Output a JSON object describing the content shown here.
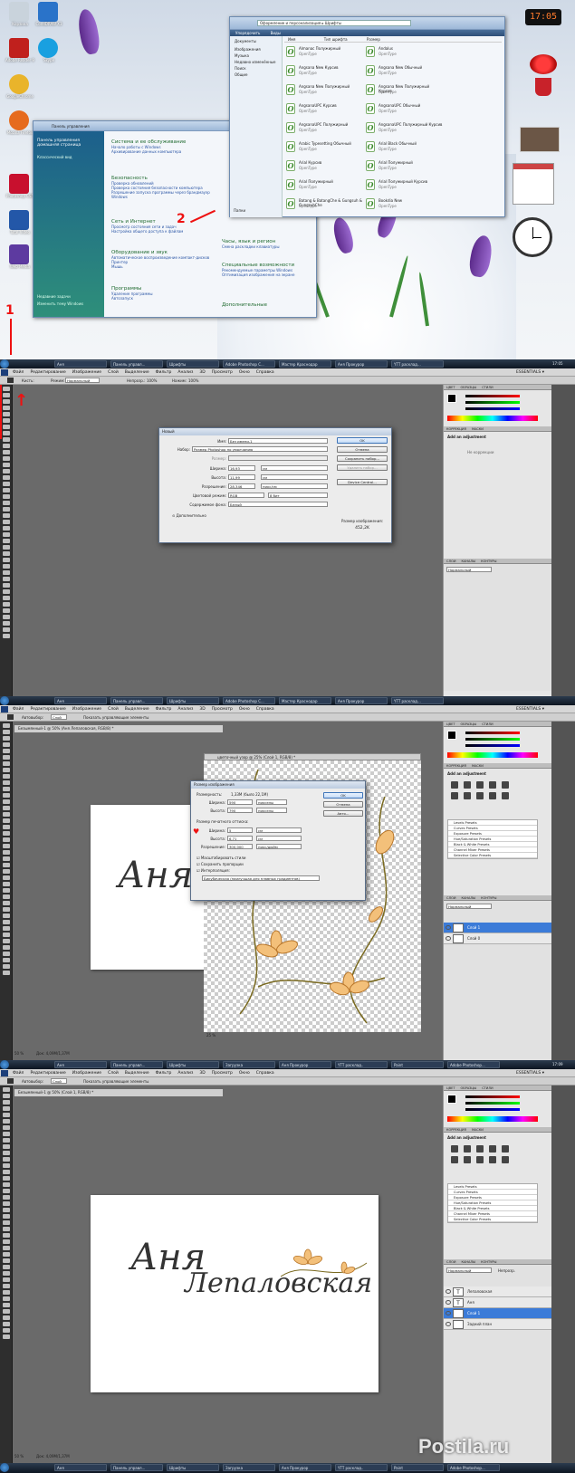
{
  "colors": {
    "accent_red": "#e11",
    "ps_bg": "#6a6a6a",
    "layer_selected": "#3b7bd8",
    "taskbar": "#0e1622"
  },
  "desktop": {
    "icons": [
      {
        "label": "Корзина",
        "icon": "recycle-bin-icon"
      },
      {
        "label": "Adobe Reader 9",
        "icon": "adobe-reader-icon"
      },
      {
        "label": "CorelDRAW X3",
        "icon": "corel-icon"
      },
      {
        "label": "Skype",
        "icon": "skype-icon"
      },
      {
        "label": "GoogleChrome",
        "icon": "chrome-icon"
      },
      {
        "label": "Mozilla Firefox",
        "icon": "firefox-icon"
      },
      {
        "label": "Photoshop CS5",
        "icon": "photoshop-icon"
      },
      {
        "label": "Total Video",
        "icon": "video-icon"
      },
      {
        "label": "Web Media",
        "icon": "media-icon"
      }
    ],
    "clock_digital": "17:05",
    "red_annotations": [
      "1",
      "2"
    ],
    "control_panel": {
      "title": "Панель управления",
      "left_links": [
        "Панель управления домашняя страница",
        "Классический вид"
      ],
      "bottom_links": [
        "Недавние задачи",
        "Изменить тему Windows"
      ],
      "sections": [
        {
          "title": "Система и ее обслуживание",
          "subs": [
            "Начало работы с Windows",
            "Архивирование данных компьютера"
          ]
        },
        {
          "title": "Безопасность",
          "subs": [
            "Проверка обновлений",
            "Проверка состояния безопасности компьютера",
            "Разрешение запуска программы через брандмауэр Windows"
          ]
        },
        {
          "title": "Сеть и Интернет",
          "subs": [
            "Просмотр состояния сети и задач",
            "Настройка общего доступа к файлам"
          ]
        },
        {
          "title": "Оборудование и звук",
          "subs": [
            "Автоматическое воспроизведение компакт-дисков",
            "Принтер",
            "Мышь"
          ]
        },
        {
          "title": "Программы",
          "subs": [
            "Удаление программы",
            "Автозапуск"
          ]
        }
      ],
      "right_sections": [
        {
          "title": "Часы, язык и регион",
          "subs": [
            "Смена раскладки клавиатуры"
          ]
        },
        {
          "title": "Специальные возможности",
          "subs": [
            "Рекомендуемые параметры Windows",
            "Оптимизация изображения на экране"
          ]
        },
        {
          "title": "Дополнительные",
          "subs": []
        }
      ]
    },
    "fonts_window": {
      "breadcrumb": "Оформление и персонализация ▸ Шрифты",
      "toolbar": [
        "Упорядочить",
        "Виды"
      ],
      "columns": [
        "Имя",
        "Тип шрифта",
        "Размер"
      ],
      "sidebar": [
        "Документы",
        "Изображения",
        "Музыка",
        "Недавно изменённые",
        "Поиск",
        "Общие"
      ],
      "folders_label": "Папки",
      "fonts": [
        {
          "name": "Almanac Полужирный",
          "type": "OpenType"
        },
        {
          "name": "Andalus",
          "type": "OpenType"
        },
        {
          "name": "Angsana New Курсив",
          "type": "OpenType"
        },
        {
          "name": "Angsana New Обычный",
          "type": "OpenType"
        },
        {
          "name": "Angsana New Полужирный",
          "type": "OpenType"
        },
        {
          "name": "Angsana New Полужирный Курсив",
          "type": "OpenType"
        },
        {
          "name": "AngsanaUPC Курсив",
          "type": "OpenType"
        },
        {
          "name": "AngsanaUPC Обычный",
          "type": "OpenType"
        },
        {
          "name": "AngsanaUPC Полужирный",
          "type": "OpenType"
        },
        {
          "name": "AngsanaUPC Полужирный Курсив",
          "type": "OpenType"
        },
        {
          "name": "Arabic Typesetting Обычный",
          "type": "OpenType"
        },
        {
          "name": "Arial Black Обычный",
          "type": "OpenType"
        },
        {
          "name": "Arial Курсив",
          "type": "OpenType"
        },
        {
          "name": "Arial Полужирный",
          "type": "OpenType"
        },
        {
          "name": "Arial Полужирный",
          "type": "OpenType"
        },
        {
          "name": "Arial Полужирный Курсив",
          "type": "OpenType"
        },
        {
          "name": "Batang & BatangChe & Gungsuh & GungsuhChe",
          "type": "OpenType"
        },
        {
          "name": "Bookdia New",
          "type": "OpenType"
        }
      ]
    },
    "taskbar": [
      "Аня",
      "Панель управл...",
      "Шрифты",
      "Adobe Photoshop C...",
      "Мастер Краснодар",
      "Аня Прокурор",
      "YTT расклад..."
    ],
    "tray_time": "17:05"
  },
  "ps_common": {
    "menu": [
      "Файл",
      "Редактирование",
      "Изображение",
      "Слой",
      "Выделение",
      "Фильтр",
      "Анализ",
      "3D",
      "Просмотр",
      "Окно",
      "Справка"
    ],
    "workspace": "ESSENTIALS ▾",
    "panel_tabs_color": [
      "ЦВЕТ",
      "ОБРАЗЦЫ",
      "СТИЛИ"
    ],
    "panel_tabs_adj": [
      "КОРРЕКЦИЯ",
      "МАСКИ"
    ],
    "panel_tabs_layers": [
      "СЛОИ",
      "КАНАЛЫ",
      "КОНТУРЫ"
    ],
    "add_adjustment": "Add an adjustment",
    "rgb": [
      "R",
      "G",
      "B"
    ],
    "no_adjustment": "Не коррекции",
    "blend_mode": "Нормальный",
    "opacity_label": "Непрозр.",
    "presets": [
      "Levels Presets",
      "Curves Presets",
      "Exposure Presets",
      "Hue/Saturation Presets",
      "Black & White Presets",
      "Channel Mixer Presets",
      "Selective Color Presets"
    ]
  },
  "ps1": {
    "options": {
      "brush_label": "Кисть:",
      "mode_label": "Режим:",
      "mode_value": "Нормальный",
      "opacity_label": "Непрозр.:",
      "opacity": "100%",
      "flow_label": "Нажим:",
      "flow": "100%"
    },
    "new_dialog": {
      "title": "Новый",
      "name_label": "Имя:",
      "name_value": "Без имени-1",
      "preset_label": "Набор:",
      "preset_value": "Размер Photoshop по умолчанию",
      "size_label": "Размер:",
      "width_label": "Ширина:",
      "width_value": "16,93",
      "width_unit": "см",
      "height_label": "Высота:",
      "height_value": "11,99",
      "height_unit": "см",
      "res_label": "Разрешение:",
      "res_value": "28,346",
      "res_unit": "пикс/см",
      "color_label": "Цветовой режим:",
      "color_value": "RGB",
      "bit_value": "8 бит",
      "bg_label": "Содержимое фона:",
      "bg_value": "Белый",
      "advanced": "Дополнительно",
      "buttons": [
        "OK",
        "Отмена",
        "Сохранить набор...",
        "Удалить набор...",
        "Device Central..."
      ],
      "size_caption": "Размер изображения:",
      "size_value": "452,2K"
    }
  },
  "ps2": {
    "options": {
      "auto_label": "Автовыбор:",
      "auto_value": "Слой",
      "transform_label": "Показать управляющие элементы"
    },
    "doc1_title": "Безымянный-1 @ 50% (Аня Лепаловская, RGB/8) *",
    "doc2_title": "цветочный узор @ 25% (Слой 1, RGB/8) *",
    "doc1_zoom": "50 %",
    "doc1_info": "Док: 4,09M/1,37M",
    "doc2_zoom": "25 %",
    "script_text": "Аня Л",
    "resize_dialog": {
      "title": "Размер изображения",
      "dim_label": "Размерность:",
      "dim_value": "1,33M (было 22,1M)",
      "w_label": "Ширина:",
      "w_value": "590",
      "w_unit": "пикселы",
      "h_label": "Высота:",
      "h_value": "790",
      "h_unit": "пикселы",
      "print_label": "Размер печатного оттиска:",
      "pw_label": "Ширина:",
      "pw_value": "5",
      "pw_unit": "см",
      "ph_label": "Высота:",
      "ph_value": "6,71",
      "ph_unit": "см",
      "pr_label": "Разрешение:",
      "pr_value": "300,000",
      "pr_unit": "пикс/дюйм",
      "checks": [
        "Масштабировать стили",
        "Сохранить пропорции",
        "Интерполяция:"
      ],
      "interp": "Бикубическая (наилучшая для плавных градиентов)",
      "buttons": [
        "OK",
        "Отмена",
        "Авто..."
      ]
    },
    "layers": [
      {
        "name": "Слой 1",
        "selected": true
      },
      {
        "name": "Слой 0",
        "selected": false
      }
    ],
    "taskbar": [
      "Аня",
      "Панель управл...",
      "Шрифты",
      "Загрузка",
      "Аня Прокурор",
      "YTT расклад..",
      "Paint",
      "Adobe Photoshop..."
    ],
    "tray_time": "17:09"
  },
  "ps3": {
    "doc_title": "Безымянный-1 @ 50% (Слой 1, RGB/8) *",
    "script_line1": "Аня",
    "script_line2": "Лепаловская",
    "zoom": "50 %",
    "info": "Док: 4,09M/1,37M",
    "layers": [
      {
        "name": "Лепаловская",
        "kind": "T",
        "selected": false
      },
      {
        "name": "Аня",
        "kind": "T",
        "selected": false
      },
      {
        "name": "Слой 1",
        "kind": "img",
        "selected": true
      },
      {
        "name": "Задний план",
        "kind": "img",
        "selected": false
      }
    ],
    "taskbar": [
      "Аня",
      "Панель управл...",
      "Шрифты",
      "Загрузка",
      "Аня Прокурор",
      "YTT расклад..",
      "Paint",
      "Adobe Photoshop..."
    ],
    "tray_time": "17:09"
  },
  "watermark": "Postila.ru"
}
